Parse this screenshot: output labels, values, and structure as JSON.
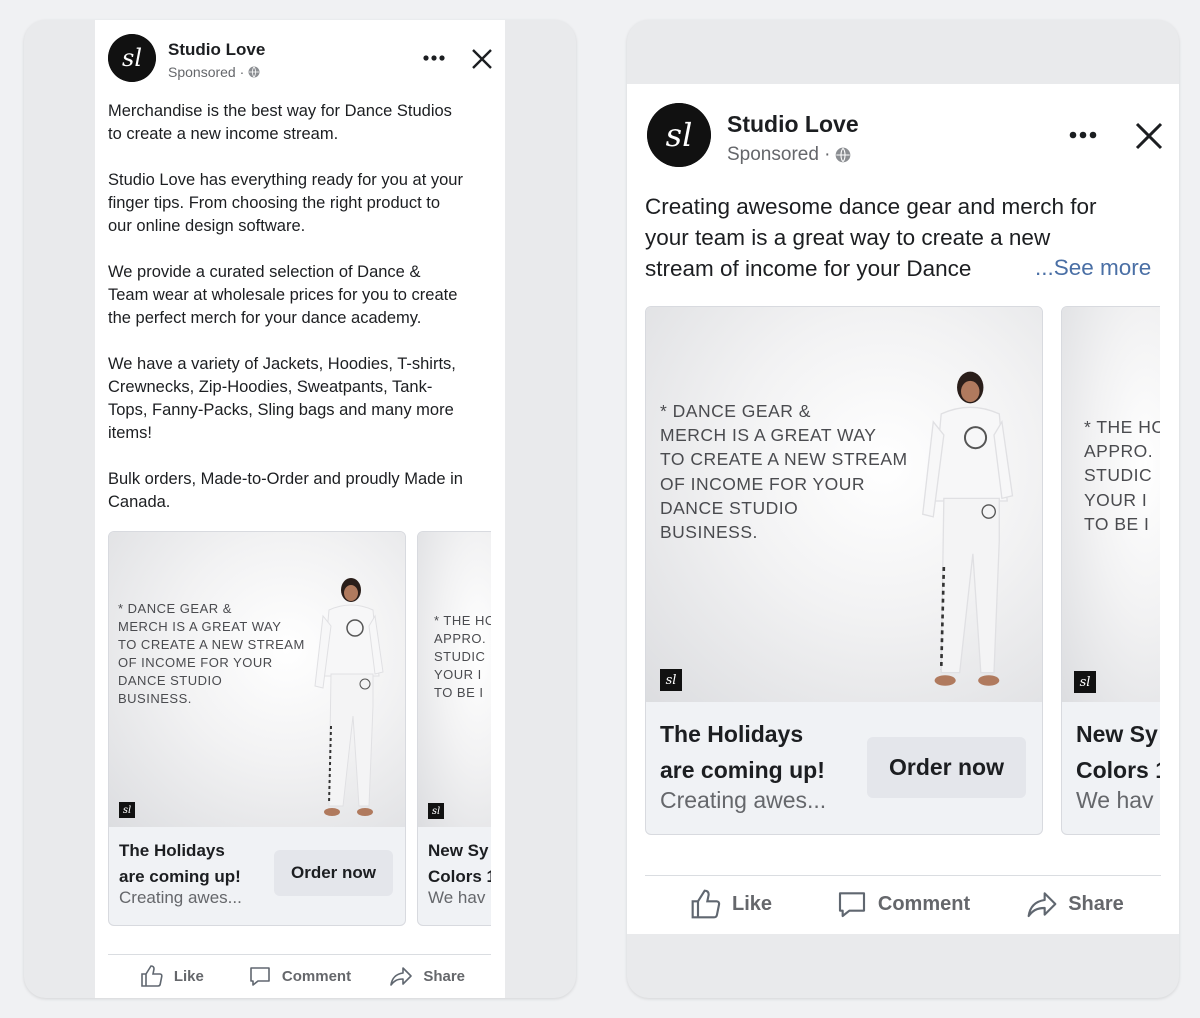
{
  "left_post": {
    "page_name": "Studio Love",
    "sponsored": "Sponsored ·",
    "avatar_initials": "sl",
    "more_icon": "more-horizontal-icon",
    "close_icon": "close-icon",
    "caption": "Merchandise is the best way for Dance Studios\nto create a new income stream.\n\nStudio Love has everything ready for you at your\nfinger tips. From choosing the right product to\nour online design software.\n\nWe provide a curated selection of Dance &\nTeam wear at wholesale prices for you to create\nthe perfect merch for your dance academy.\n\nWe have a variety of Jackets, Hoodies, T-shirts,\nCrewnecks, Zip-Hoodies, Sweatpants, Tank-\nTops, Fanny-Packs, Sling bags and many more\nitems!\n\nBulk orders, Made-to-Order and proudly Made in\nCanada.",
    "cards": [
      {
        "quote": "* DANCE GEAR &\n  MERCH IS A GREAT WAY\n  TO CREATE A NEW STREAM\n  OF INCOME FOR YOUR\n  DANCE STUDIO\n  BUSINESS.",
        "title": "The Holidays\nare coming up!",
        "description": "Creating awes...",
        "cta": "Order now"
      },
      {
        "quote": "* THE HC\n  APPRO.\n  STUDIC\n  YOUR I\n  TO BE I",
        "title": "New Sy\nColors 1",
        "description": "We hav",
        "cta": ""
      }
    ],
    "actions": [
      "Like",
      "Comment",
      "Share"
    ]
  },
  "right_post": {
    "page_name": "Studio Love",
    "sponsored": "Sponsored ·",
    "avatar_initials": "sl",
    "caption": "Creating awesome dance gear and merch for\nyour team is a great way to create a new\nstream of income for your Dance",
    "see_more": "...See more",
    "cards": [
      {
        "quote": "* DANCE GEAR &\n  MERCH IS A GREAT WAY\n  TO CREATE A NEW STREAM\n  OF INCOME FOR YOUR\n  DANCE STUDIO\n  BUSINESS.",
        "title": "The Holidays\nare coming up!",
        "description": "Creating awes...",
        "cta": "Order now"
      },
      {
        "quote": "* THE HC\n  APPRO.\n  STUDIC\n  YOUR I\n  TO BE I",
        "title": "New Sy\nColors 1",
        "description": "We hav",
        "cta": ""
      }
    ],
    "actions": [
      "Like",
      "Comment",
      "Share"
    ]
  }
}
